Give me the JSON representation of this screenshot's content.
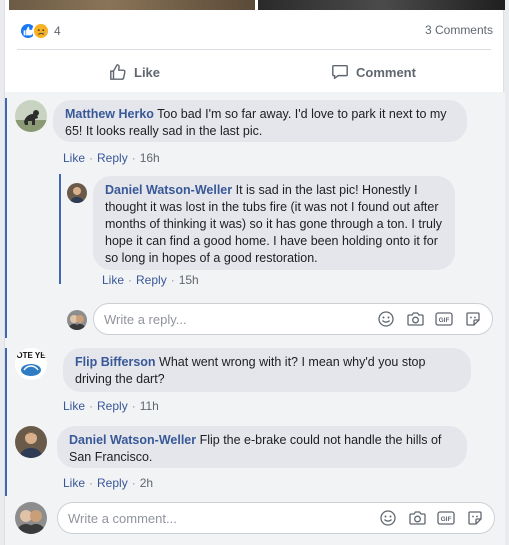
{
  "post": {
    "reactions": {
      "count": "4",
      "icons": [
        "like-reaction",
        "sad-reaction"
      ]
    },
    "comments_count": "3 Comments",
    "actions": {
      "like": "Like",
      "comment": "Comment"
    }
  },
  "comments": [
    {
      "author": "Matthew Herko",
      "text": "Too bad I'm so far away. I'd love to park it next to my 65! It looks really sad in the last pic.",
      "like": "Like",
      "reply": "Reply",
      "time": "16h"
    },
    {
      "author": "Flip Bifferson",
      "text": "What went wrong with it? I mean why'd you stop driving the dart?",
      "like": "Like",
      "reply": "Reply",
      "time": "11h"
    },
    {
      "author": "Daniel Watson-Weller",
      "text": "Flip the e-brake could not handle the hills of San Francisco.",
      "like": "Like",
      "reply": "Reply",
      "time": "2h"
    }
  ],
  "replies": [
    {
      "author": "Daniel Watson-Weller",
      "text": "It is sad in the last pic! Honestly I thought it was lost in the tubs fire (it was not I found out after months of thinking it was) so it has gone through a ton. I truly hope it can find a good home. I have been holding onto it for so long in hopes of a good restoration.",
      "like": "Like",
      "reply": "Reply",
      "time": "15h"
    }
  ],
  "reply_box": {
    "placeholder": "Write a reply..."
  },
  "comment_box": {
    "placeholder": "Write a comment..."
  },
  "avatar_badge_text": "VOTE YES",
  "input_icons": [
    "emoji-icon",
    "camera-icon",
    "gif-icon",
    "sticker-icon"
  ],
  "gif_label": "GIF",
  "colors": {
    "link": "#385898",
    "accent": "#4267b2",
    "bubble": "#e4e6eb"
  }
}
